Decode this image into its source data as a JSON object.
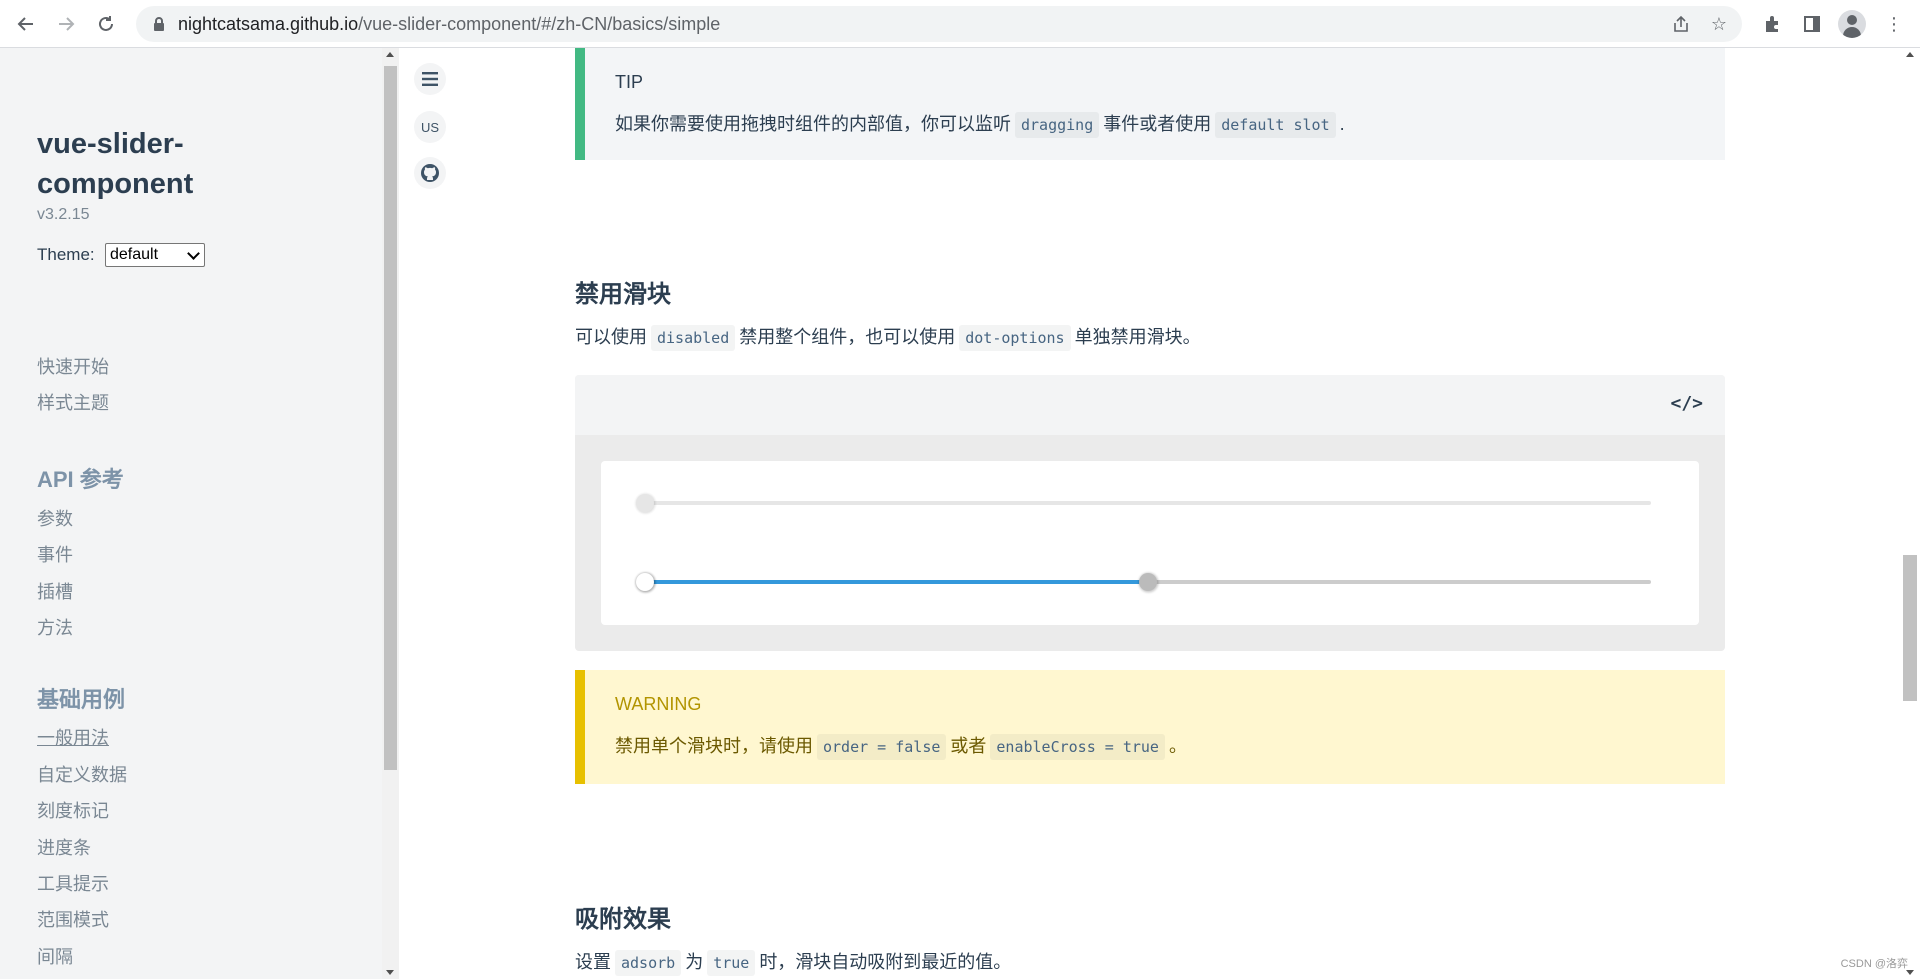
{
  "browser": {
    "url_host": "nightcatsama.github.io",
    "url_path": "/vue-slider-component/#/zh-CN/basics/simple"
  },
  "sidebar": {
    "title": "vue-slider-component",
    "version": "v3.2.15",
    "theme_label": "Theme:",
    "theme_value": "default",
    "links_top": [
      "快速开始",
      "样式主题"
    ],
    "group_api": "API 参考",
    "api_links": [
      "参数",
      "事件",
      "插槽",
      "方法"
    ],
    "group_basics": "基础用例",
    "basic_links": [
      "一般用法",
      "自定义数据",
      "刻度标记",
      "进度条",
      "工具提示",
      "范围模式",
      "间隔"
    ]
  },
  "floating": {
    "lang": "US"
  },
  "tip": {
    "title": "TIP",
    "text1": "如果你需要使用拖拽时组件的内部值，你可以监听",
    "code1": "dragging",
    "text2": "事件或者使用",
    "code2": "default slot",
    "text3": "."
  },
  "section_disable": {
    "heading": "禁用滑块",
    "text1": "可以使用",
    "code1": "disabled",
    "text2": "禁用整个组件，也可以使用",
    "code2": "dot-options",
    "text3": "单独禁用滑块。"
  },
  "demo": {
    "code_toggle": "</>",
    "slider1_value": 0,
    "slider2_values": [
      0,
      50
    ]
  },
  "warning": {
    "title": "WARNING",
    "text1": "禁用单个滑块时，请使用",
    "code1": "order = false",
    "text2": "或者",
    "code2": "enableCross = true",
    "text3": "。"
  },
  "section_adsorb": {
    "heading": "吸附效果",
    "text1": "设置",
    "code1": "adsorb",
    "text2": "为",
    "code2": "true",
    "text3": "时，滑块自动吸附到最近的值。"
  },
  "watermark": "CSDN @洛弈"
}
